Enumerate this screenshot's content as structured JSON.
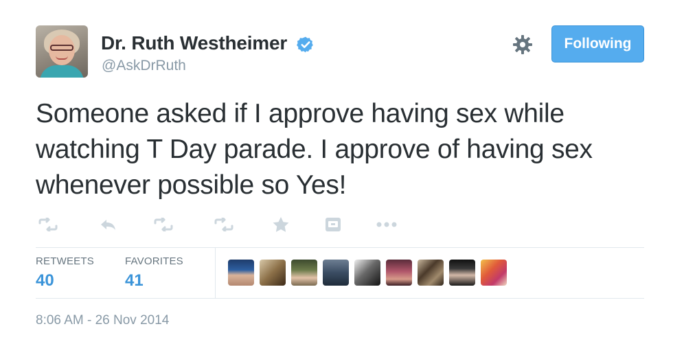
{
  "user": {
    "display_name": "Dr. Ruth Westheimer",
    "screen_name": "@AskDrRuth",
    "verified": true
  },
  "follow_button": {
    "label": "Following"
  },
  "tweet": {
    "text": "Someone asked if I approve having sex while watching T Day parade. I approve of having sex whenever possible so Yes!"
  },
  "actions": [
    "retweet",
    "reply",
    "retweet",
    "retweet",
    "favorite",
    "embed",
    "more"
  ],
  "stats": {
    "retweets_label": "RETWEETS",
    "retweets_value": "40",
    "favorites_label": "FAVORITES",
    "favorites_value": "41"
  },
  "timestamp": "8:06 AM - 26 Nov 2014",
  "colors": {
    "accent": "#55acee",
    "link": "#3b94d9",
    "text": "#292f33",
    "muted": "#8899a6",
    "divider": "#e1e8ed"
  },
  "favoriters_count_shown": 9
}
